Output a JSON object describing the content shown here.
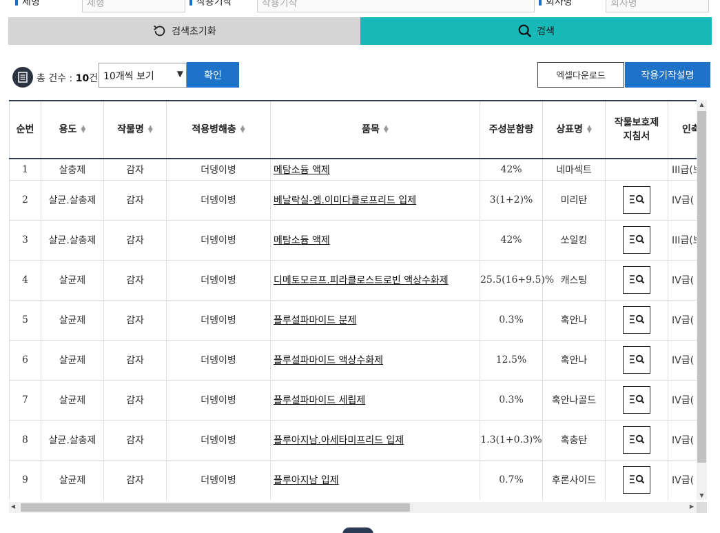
{
  "filters": {
    "formulation_label": "제형",
    "formulation_placeholder": "제형",
    "mode_label": "작용기작",
    "mode_placeholder": "작용기작",
    "company_label": "회사명",
    "company_placeholder": "회사명"
  },
  "search": {
    "reset_label": "검색초기화",
    "search_label": "검색"
  },
  "toolbar": {
    "count_prefix": "총 건수 : ",
    "count_value": "10",
    "count_suffix": "건",
    "page_size": "10개씩 보기",
    "confirm_label": "확인",
    "excel_label": "엑셀다운로드",
    "guide_label": "작용기작설명"
  },
  "table": {
    "headers": [
      "순번",
      "용도",
      "작물명",
      "적용병해충",
      "품목",
      "주성분함량",
      "상표명",
      "작물보호제\n지침서",
      "인축"
    ],
    "rows": [
      {
        "no": "1",
        "use": "살충제",
        "crop": "감자",
        "pest": "더뎅이병",
        "item": "메탐소듐 액제",
        "content": "42%",
        "brand": "네마섹트",
        "guide": false,
        "tox": "III급(보"
      },
      {
        "no": "2",
        "use": "살균.살충제",
        "crop": "감자",
        "pest": "더뎅이병",
        "item": "베날락실-엠.이미다클로프리드 입제",
        "content": "3(1+2)%",
        "brand": "미리탄",
        "guide": true,
        "tox": "IV급("
      },
      {
        "no": "3",
        "use": "살균.살충제",
        "crop": "감자",
        "pest": "더뎅이병",
        "item": "메탐소듐 액제",
        "content": "42%",
        "brand": "쏘일킹",
        "guide": true,
        "tox": "III급(보"
      },
      {
        "no": "4",
        "use": "살균제",
        "crop": "감자",
        "pest": "더뎅이병",
        "item": "디메토모르프.피라클로스트로빈 액상수화제",
        "content": "25.5(16+9.5)%",
        "brand": "캐스팅",
        "guide": true,
        "tox": "IV급("
      },
      {
        "no": "5",
        "use": "살균제",
        "crop": "감자",
        "pest": "더뎅이병",
        "item": "플루설파마이드 분제",
        "content": "0.3%",
        "brand": "혹안나",
        "guide": true,
        "tox": "IV급("
      },
      {
        "no": "6",
        "use": "살균제",
        "crop": "감자",
        "pest": "더뎅이병",
        "item": "플루설파마이드 액상수화제",
        "content": "12.5%",
        "brand": "혹안나",
        "guide": true,
        "tox": "IV급("
      },
      {
        "no": "7",
        "use": "살균제",
        "crop": "감자",
        "pest": "더뎅이병",
        "item": "플루설파마이드 세립제",
        "content": "0.3%",
        "brand": "혹안나골드",
        "guide": true,
        "tox": "IV급("
      },
      {
        "no": "8",
        "use": "살균.살충제",
        "crop": "감자",
        "pest": "더뎅이병",
        "item": "플루아지남.아세타미프리드 입제",
        "content": "1.3(1+0.3)%",
        "brand": "혹충탄",
        "guide": true,
        "tox": "IV급("
      },
      {
        "no": "9",
        "use": "살균제",
        "crop": "감자",
        "pest": "더뎅이병",
        "item": "플루아지남 입제",
        "content": "0.7%",
        "brand": "후론사이드",
        "guide": true,
        "tox": "IV급("
      }
    ]
  },
  "colors": {
    "search_bg": "#17b8b8",
    "primary_button": "#1e73c8",
    "header_rule": "#2b3a55"
  }
}
